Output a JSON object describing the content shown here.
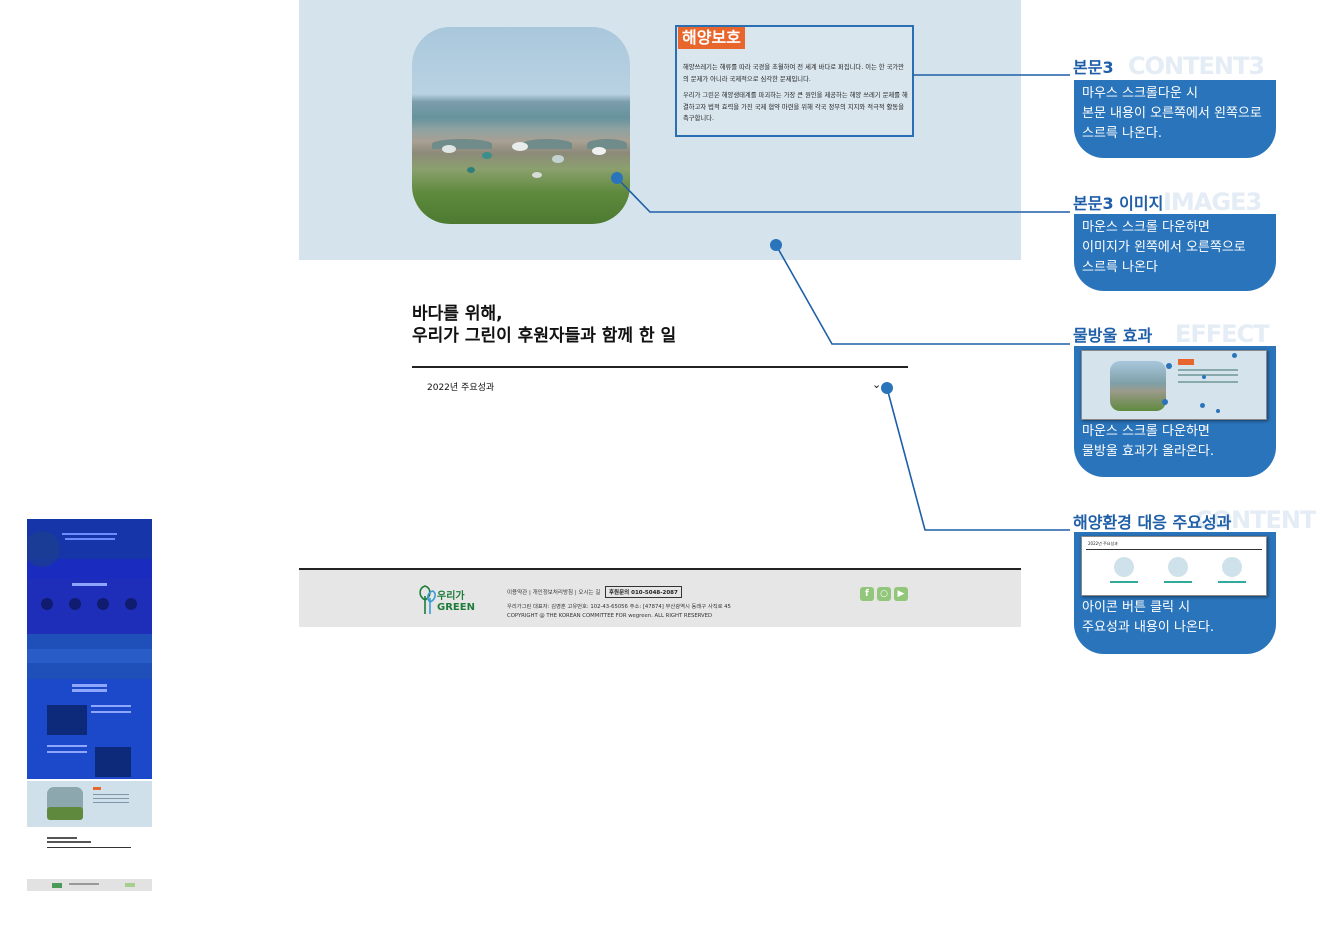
{
  "content3": {
    "badge": "해양보호",
    "para1": "해양쓰레기는 해류를 따라 국경을 초월하여 전 세계 바다로 퍼집니다. 이는 한 국가만의 문제가 아니라 국제적으로 심각한 문제입니다.",
    "para2": "우리가 그린은 해양생태계를 파괴하는 가장 큰 원인을 제공하는 해양 쓰레기 문제를 해결하고자 법적 효력을 가진 국제 협약 마련을 위해 각국 정부의 지지와 적극적 활동을 촉구합니다."
  },
  "section": {
    "title_line1": "바다를 위해,",
    "title_line2": "우리가 그린이 후원자들과 함께 한 일",
    "accordion_label": "2022년 주요성과"
  },
  "footer": {
    "logo_line1": "우리가",
    "logo_line2": "GREEN",
    "links": "이용약관 | 개인정보처리방침 | 오시는 길",
    "phone": "후원문의 010-5048-2087",
    "address": "우리가그린 대표자: 김영훈 고유번호: 102-43-65056 주소: [47874] 부산광역시 동래구 사직로 45",
    "copyright": "COPYRIGHT @ THE KOREAN COMMITTEE FOR wegreen. ALL RIGHT RESERVED",
    "sns": [
      "facebook-icon",
      "instagram-icon",
      "youtube-icon"
    ]
  },
  "annotations": [
    {
      "title": "본문3",
      "ghost": "CONTENT3",
      "desc_lines": [
        "마우스 스크롤다운 시",
        "본문 내용이 오른쪽에서 왼쪽으로",
        "스르륵 나온다."
      ]
    },
    {
      "title": "본문3 이미지",
      "ghost": "IMAGE3",
      "desc_lines": [
        "마운스 스크롤 다운하면",
        "이미지가 왼쪽에서 오른쪽으로",
        "스르륵 나온다"
      ]
    },
    {
      "title": "물방울 효과",
      "ghost": "EFFECT",
      "desc_lines": [
        "마운스 스크롤 다운하면",
        "물방울 효과가 올라온다."
      ]
    },
    {
      "title": "해양환경 대응 주요성과",
      "ghost": "CONTENT",
      "desc_lines": [
        "아이콘 버튼 클릭 시",
        "주요성과 내용이 나온다."
      ]
    }
  ],
  "colors": {
    "accent": "#2a74bb",
    "badge": "#e8662b",
    "hero_bg": "#d4e3ec",
    "mini_blue": "#1a3fc4"
  }
}
